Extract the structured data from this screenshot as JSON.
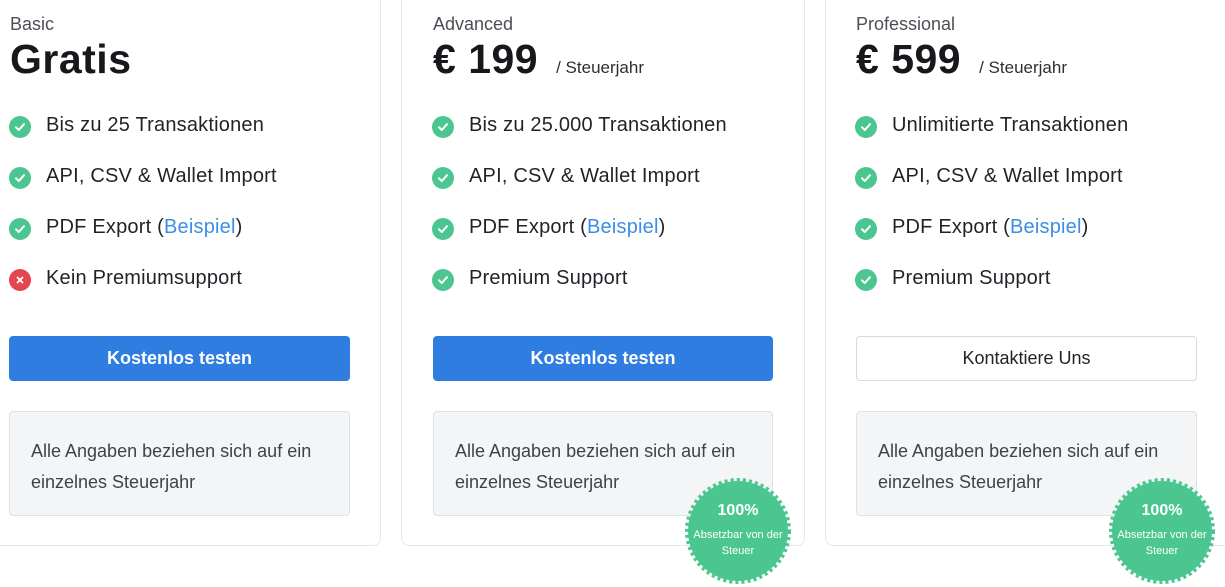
{
  "plans": [
    {
      "tier": "Basic",
      "price": "Gratis",
      "period": "",
      "features": [
        {
          "included": true,
          "text": "Bis zu 25 Transaktionen"
        },
        {
          "included": true,
          "text": "API, CSV & Wallet Import"
        },
        {
          "included": true,
          "text_before": "PDF Export (",
          "link": "Beispiel",
          "text_after": ")"
        },
        {
          "included": false,
          "text": "Kein Premiumsupport"
        }
      ],
      "cta": "Kostenlos testen",
      "note": "Alle Angaben beziehen sich auf ein einzelnes Steuerjahr"
    },
    {
      "tier": "Advanced",
      "price": "€ 199",
      "period": "/ Steuerjahr",
      "features": [
        {
          "included": true,
          "text": "Bis zu 25.000 Transaktionen"
        },
        {
          "included": true,
          "text": "API, CSV & Wallet Import"
        },
        {
          "included": true,
          "text_before": "PDF Export (",
          "link": "Beispiel",
          "text_after": ")"
        },
        {
          "included": true,
          "text": "Premium Support"
        }
      ],
      "cta": "Kostenlos testen",
      "note": "Alle Angaben beziehen sich auf ein einzelnes Steuerjahr",
      "badge": {
        "percent": "100%",
        "text": "Absetzbar von der Steuer"
      }
    },
    {
      "tier": "Professional",
      "price": "€ 599",
      "period": "/ Steuerjahr",
      "features": [
        {
          "included": true,
          "text": "Unlimitierte Transaktionen"
        },
        {
          "included": true,
          "text": "API, CSV & Wallet Import"
        },
        {
          "included": true,
          "text_before": "PDF Export (",
          "link": "Beispiel",
          "text_after": ")"
        },
        {
          "included": true,
          "text": "Premium Support"
        }
      ],
      "cta": "Kontaktiere Uns",
      "note": "Alle Angaben beziehen sich auf ein einzelnes Steuerjahr",
      "badge": {
        "percent": "100%",
        "text": "Absetzbar von der Steuer"
      }
    }
  ],
  "colors": {
    "check": "#4cc690",
    "cross": "#e4464f",
    "primary_button": "#2f7de1",
    "link": "#3b8ee6",
    "badge": "#4cc690"
  }
}
